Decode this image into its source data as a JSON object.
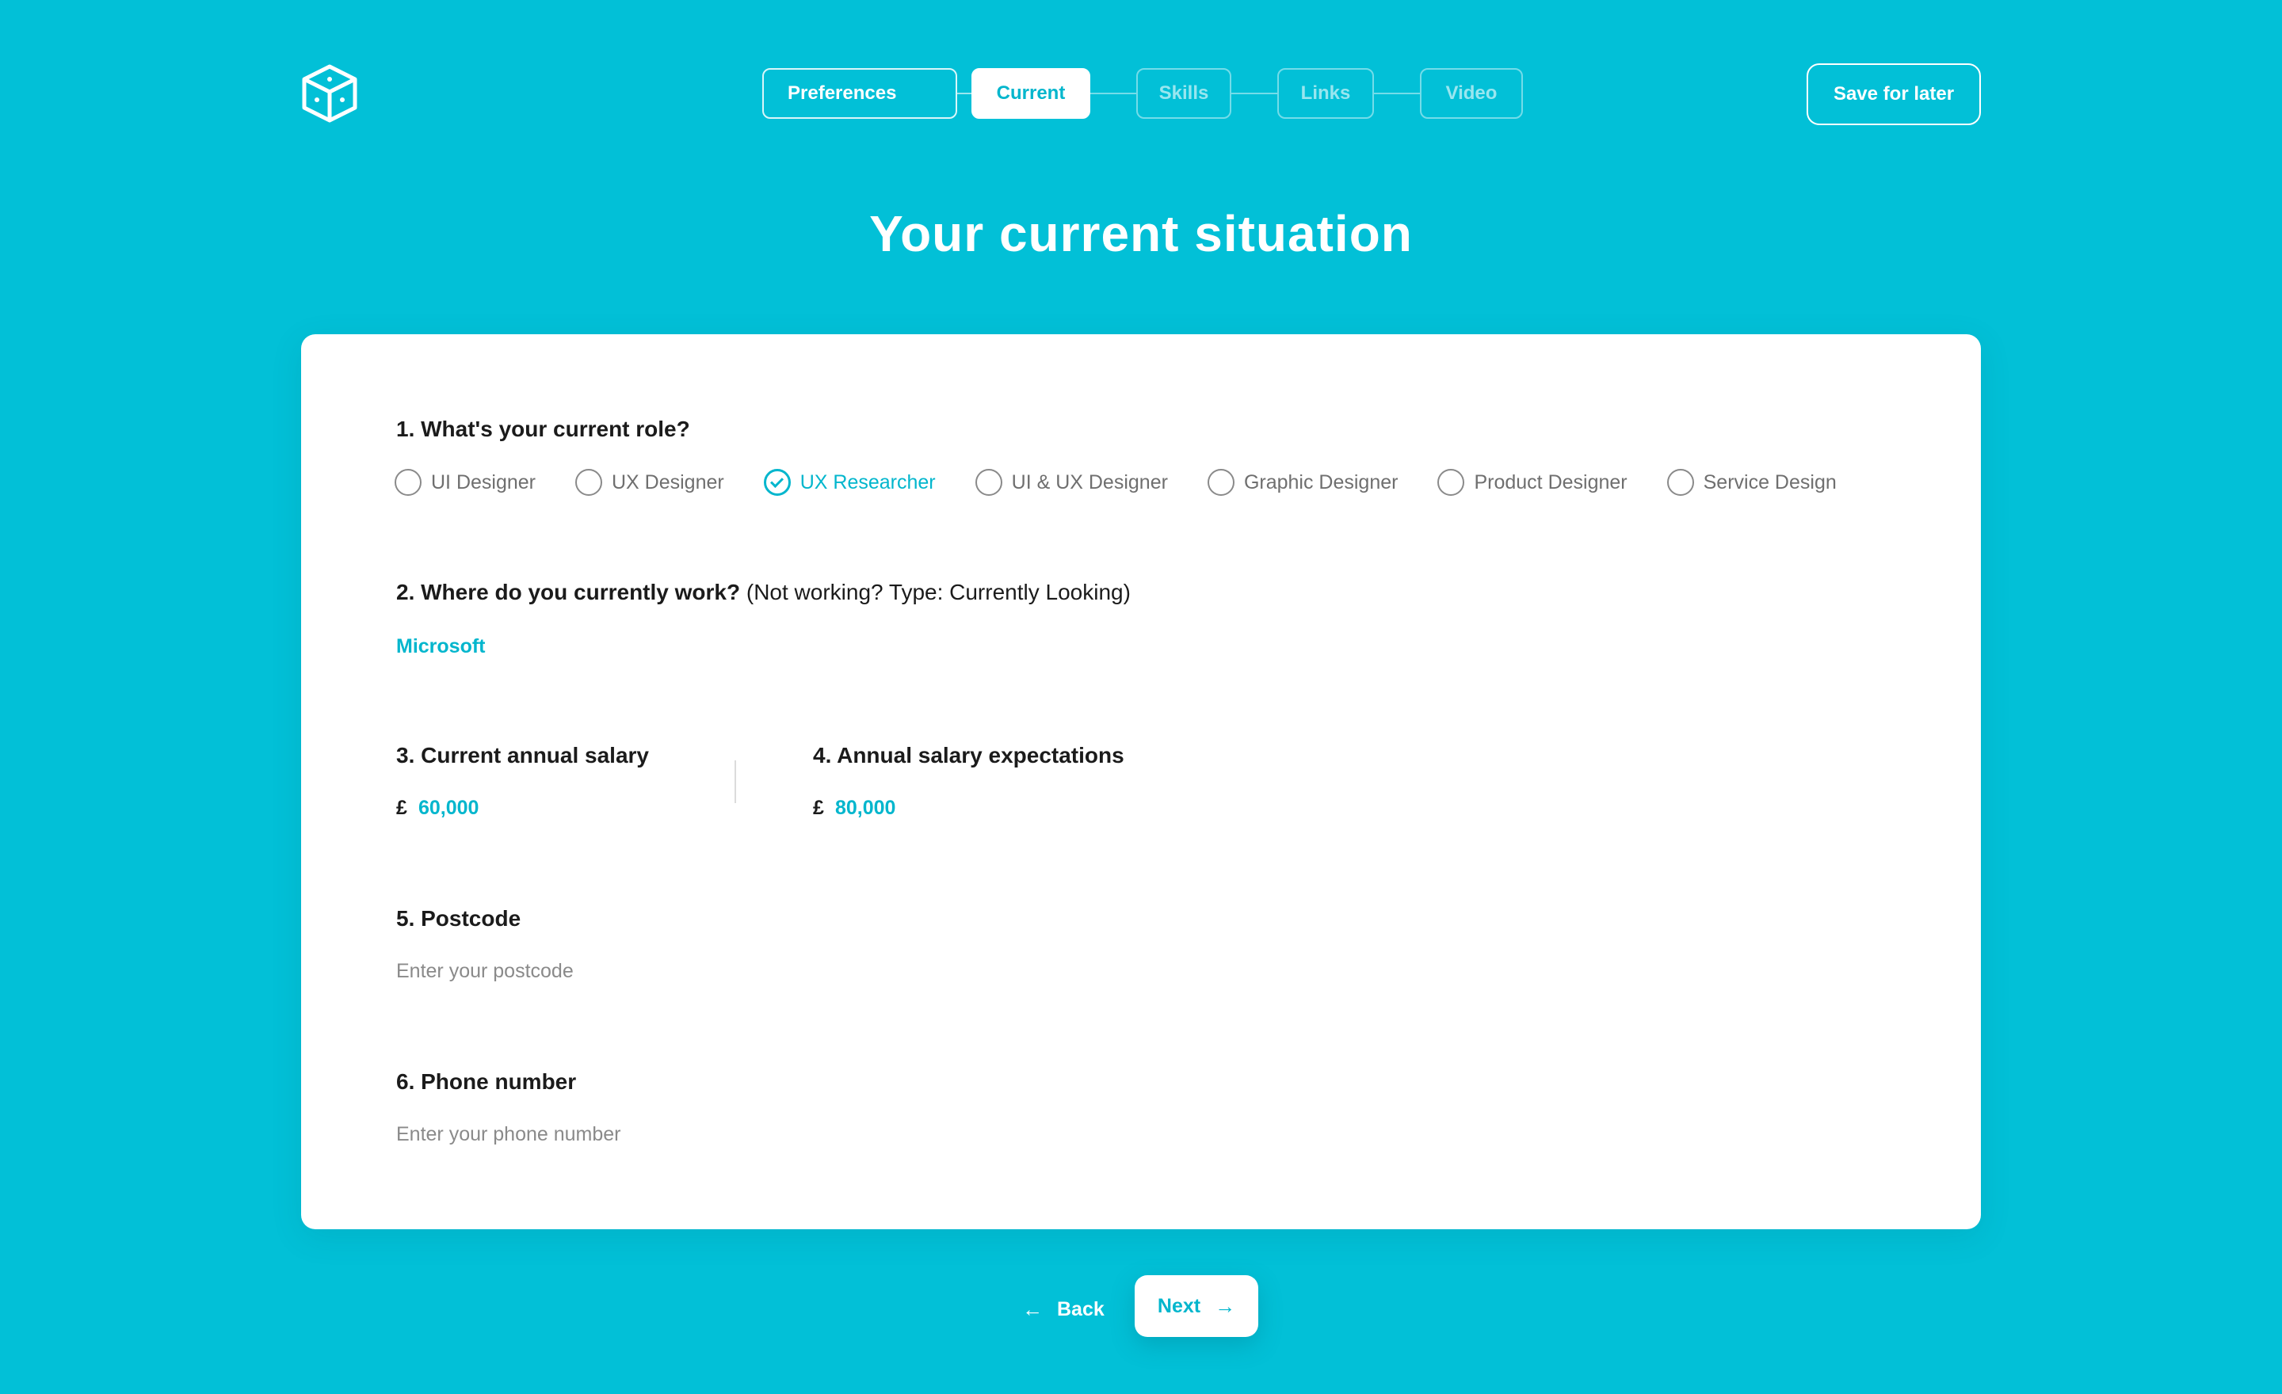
{
  "header": {
    "logo_icon": "cube-logo-icon",
    "steps": [
      {
        "label": "Preferences",
        "state": "done"
      },
      {
        "label": "Current",
        "state": "active"
      },
      {
        "label": "Skills",
        "state": "todo"
      },
      {
        "label": "Links",
        "state": "todo"
      },
      {
        "label": "Video",
        "state": "todo"
      }
    ],
    "save_label": "Save for later"
  },
  "page": {
    "title": "Your current situation"
  },
  "form": {
    "q1": {
      "title": "1. What's your current role?",
      "options": [
        "UI Designer",
        "UX Designer",
        "UX Researcher",
        "UI & UX Designer",
        "Graphic Designer",
        "Product Designer",
        "Service Design"
      ],
      "selected": "UX Researcher"
    },
    "q2": {
      "title": "2. Where do you currently work?",
      "hint": "(Not working? Type: Currently Looking)",
      "value": "Microsoft"
    },
    "q3": {
      "title": "3. Current annual salary",
      "currency": "£",
      "value": "60,000"
    },
    "q4": {
      "title": "4. Annual salary expectations",
      "currency": "£",
      "value": "80,000"
    },
    "q5": {
      "title": "5. Postcode",
      "placeholder": "Enter your postcode"
    },
    "q6": {
      "title": "6. Phone number",
      "placeholder": "Enter your phone number"
    }
  },
  "footer": {
    "back_label": "Back",
    "next_label": "Next"
  },
  "colors": {
    "background": "#02c0d7",
    "accent": "#02b6cd",
    "card": "#ffffff"
  }
}
